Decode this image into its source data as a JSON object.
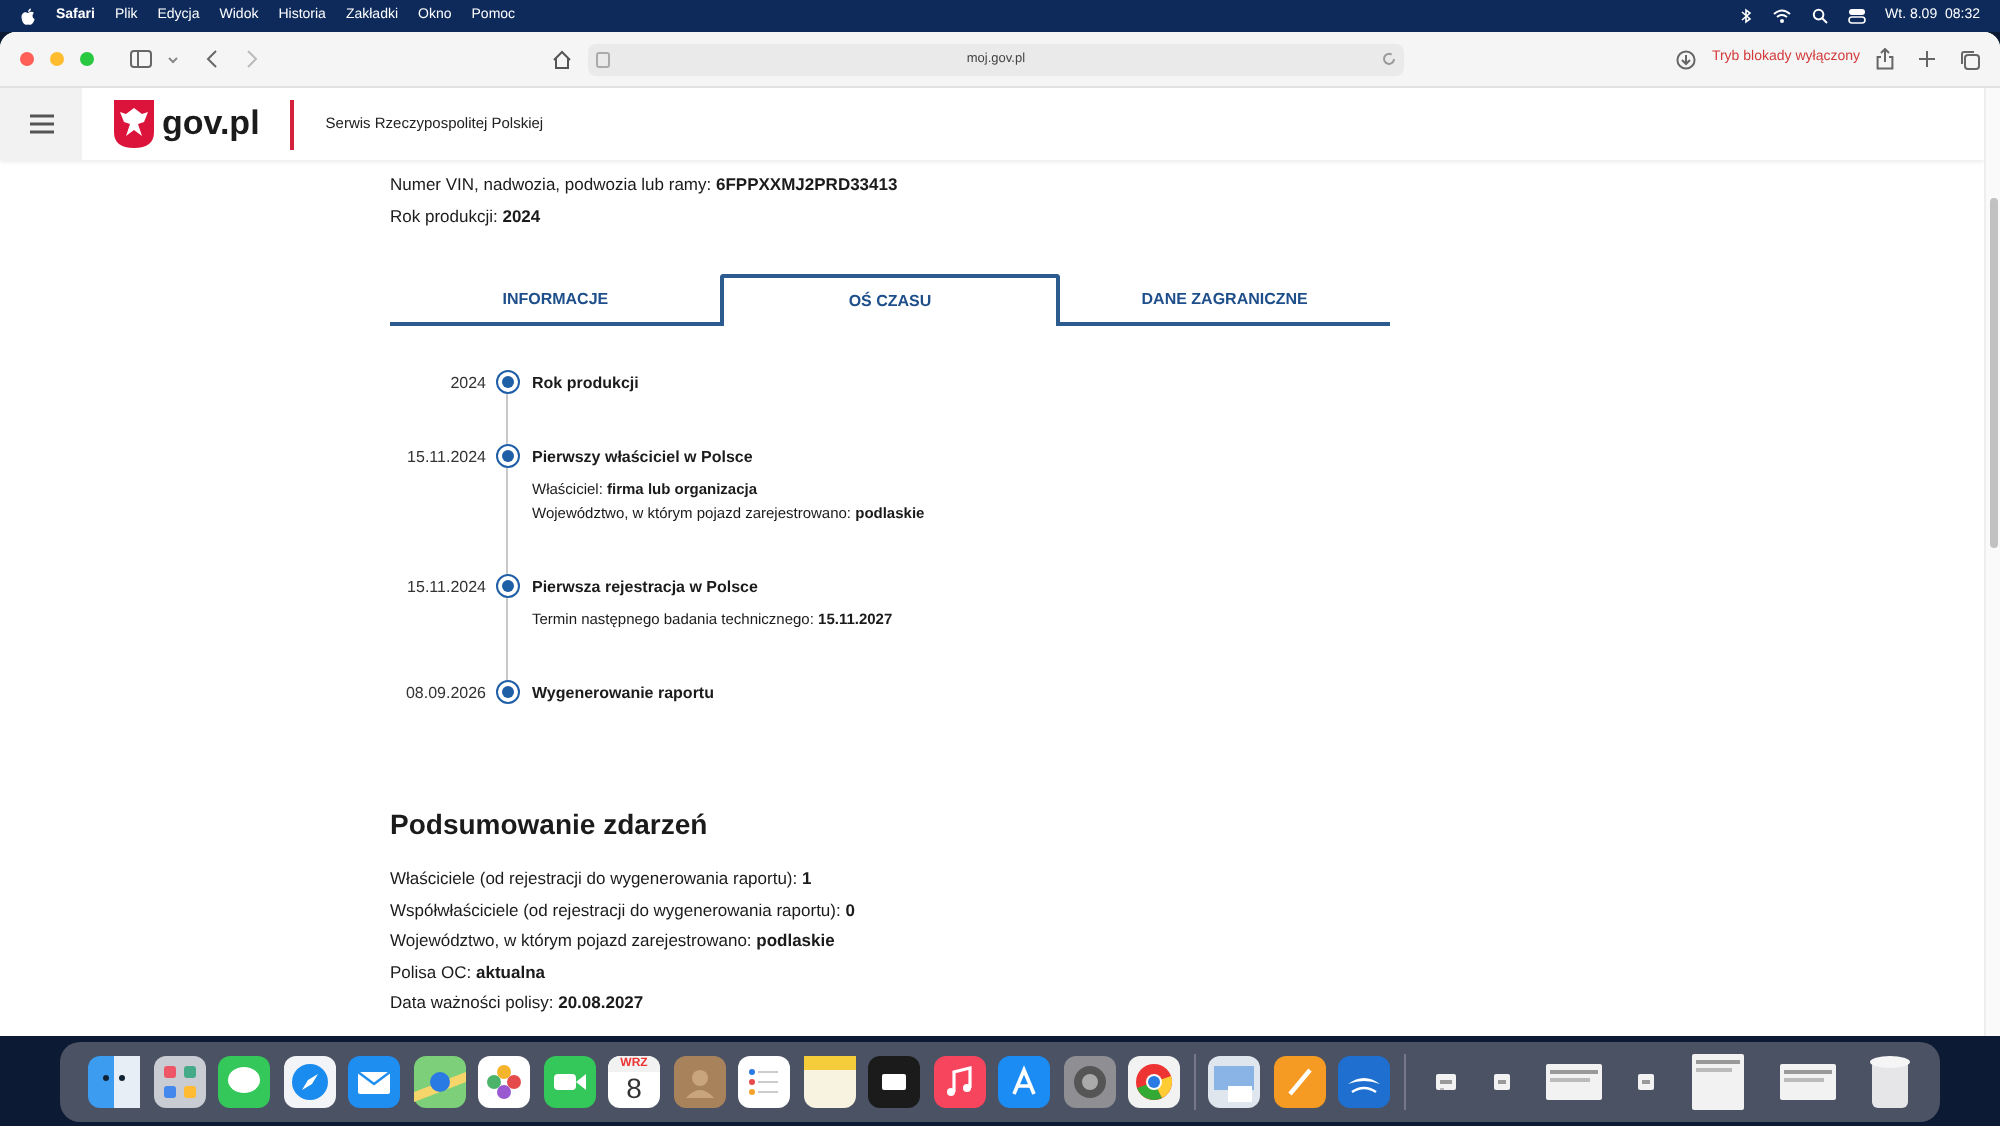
{
  "menu_bar": {
    "app": "Safari",
    "items": [
      "Plik",
      "Edycja",
      "Widok",
      "Historia",
      "Zakładki",
      "Okno",
      "Pomoc"
    ],
    "clock": "Wt. 8.09  08:32"
  },
  "toolbar": {
    "address": "moj.gov.pl",
    "blocker_status": "Tryb blokady wyłączony"
  },
  "header": {
    "logo": "gov.pl",
    "service": "Serwis Rzeczypospolitej Polskiej"
  },
  "vehicle": [
    {
      "label": "Numer VIN, nadwozia, podwozia lub ramy: ",
      "value": "6FPPXXMJ2PRD33413"
    },
    {
      "label": "Rok produkcji: ",
      "value": "2024"
    }
  ],
  "tabs": [
    {
      "label": "INFORMACJE",
      "selected": false
    },
    {
      "label": "OŚ CZASU",
      "selected": true
    },
    {
      "label": "DANE ZAGRANICZNE",
      "selected": false
    }
  ],
  "timeline": [
    {
      "date": "2024",
      "title": "Rok produkcji"
    },
    {
      "date": "15.11.2024",
      "title": "Pierwszy właściciel w Polsce",
      "details": [
        {
          "label": "Właściciel: ",
          "value": "firma lub organizacja"
        },
        {
          "label": "Województwo, w którym pojazd zarejestrowano: ",
          "value": "podlaskie"
        }
      ]
    },
    {
      "date": "15.11.2024",
      "title": "Pierwsza rejestracja w Polsce",
      "details": [
        {
          "label": "Termin następnego badania technicznego: ",
          "value": "15.11.2027"
        }
      ]
    },
    {
      "date": "08.09.2026",
      "title": "Wygenerowanie raportu"
    }
  ],
  "summary": {
    "title": "Podsumowanie zdarzeń",
    "items": [
      {
        "label": "Właściciele (od rejestracji do wygenerowania raportu): ",
        "value": "1"
      },
      {
        "label": "Współwłaściciele (od rejestracji do wygenerowania raportu): ",
        "value": "0"
      },
      {
        "label": "Województwo, w którym pojazd zarejestrowano: ",
        "value": "podlaskie"
      },
      {
        "label": "Polisa OC: ",
        "value": "aktualna"
      },
      {
        "label": "Data ważności polisy: ",
        "value": "20.08.2027"
      }
    ]
  },
  "dock": {
    "calendar": {
      "month": "WRZ",
      "day": "8"
    }
  }
}
